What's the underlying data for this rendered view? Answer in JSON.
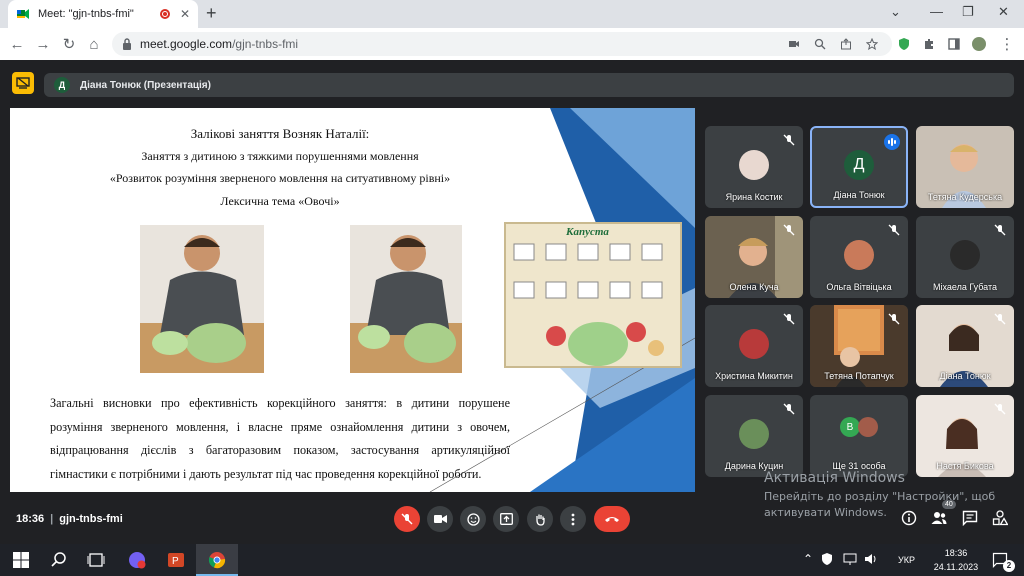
{
  "browser": {
    "tab_title": "Meet: \"gjn-tnbs-fmi\"",
    "tab_close": "✕",
    "new_tab": "+",
    "url_host": "meet.google.com",
    "url_path": "/gjn-tnbs-fmi",
    "win_min": "—",
    "win_restore": "❐",
    "win_close": "✕",
    "win_menu": "⌄"
  },
  "meet": {
    "presenter_initial": "Д",
    "presenter_label": "Діана Тонюк (Презентація)",
    "meeting_time": "18:36",
    "meeting_code": "gjn-tnbs-fmi",
    "people_count": "40"
  },
  "slide": {
    "title": "Залікові заняття  Возняк Наталії:",
    "line2": "Заняття  з дитиною з тяжкими порушеннями мовлення",
    "line3": "«Розвиток розуміння зверненого мовлення на ситуативному рівні»",
    "line4": "Лексична тема «Овочі»",
    "poster_title": "Капуста",
    "summary": "Загальні висновки про ефективність корекційного заняття: в дитини порушене розуміння зверненого мовлення, і власне пряме ознайомлення дитини з овочем, відпрацювання дієслів з багаторазовим показом, застосування артикуляційної гімнастики є потрібними і дають результат під час проведення корекційної роботи."
  },
  "participants": [
    {
      "name": "Ярина Костик"
    },
    {
      "name": "Діана Тонюк",
      "initial": "Д"
    },
    {
      "name": "Тетяна Кудерська"
    },
    {
      "name": "Олена Куча"
    },
    {
      "name": "Ольга Вітвіцька"
    },
    {
      "name": "Міхаела Губата"
    },
    {
      "name": "Христина Микитин"
    },
    {
      "name": "Тетяна Потапчук"
    },
    {
      "name": "Діана Тонюк"
    },
    {
      "name": "Дарина Куцин"
    },
    {
      "name": "Ще 31 особа",
      "initial": "В"
    },
    {
      "name": "Настя Бикова"
    }
  ],
  "windows": {
    "activation_title": "Активація Windows",
    "activation_line1": "Перейдіть до розділу \"Настройки\", щоб",
    "activation_line2": "активувати Windows.",
    "lang": "УКР",
    "clock_time": "18:36",
    "clock_date": "24.11.2023",
    "notif_count": "2"
  },
  "colors": {
    "meet_bg": "#202124",
    "tile_bg": "#3c4043",
    "accent_blue": "#8ab4f8",
    "mic_off_red": "#ea4335",
    "present_yellow": "#fbbc04"
  }
}
